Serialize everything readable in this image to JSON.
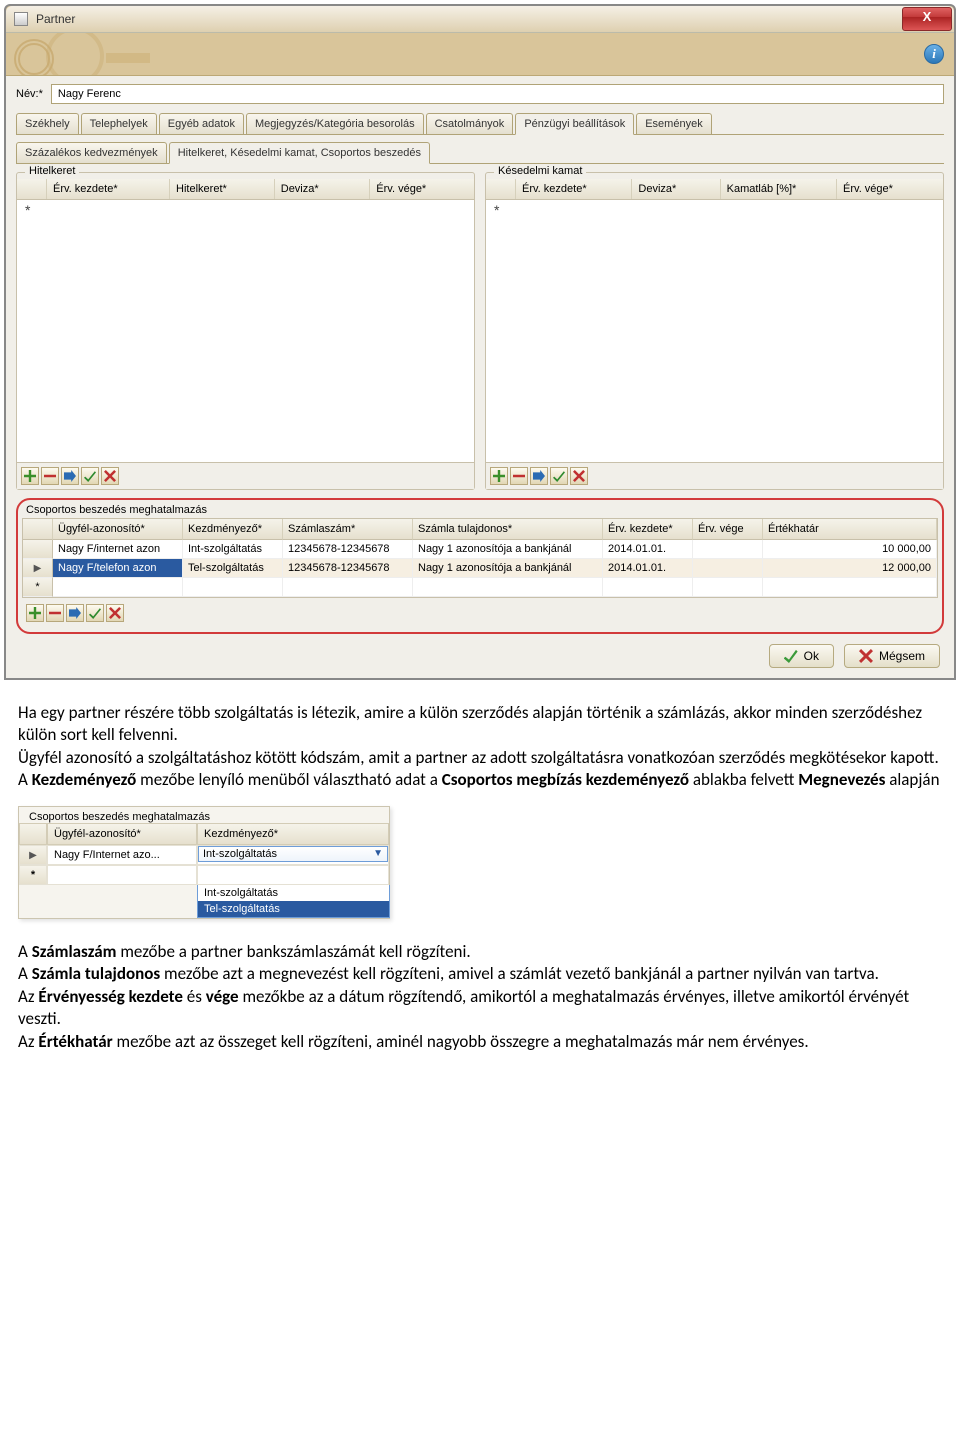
{
  "window": {
    "title": "Partner"
  },
  "name": {
    "label": "Név:*",
    "value": "Nagy Ferenc"
  },
  "main_tabs": {
    "items": [
      "Székhely",
      "Telephelyek",
      "Egyéb adatok",
      "Megjegyzés/Kategória besorolás",
      "Csatolmányok",
      "Pénzügyi beállítások",
      "Események"
    ],
    "active_index": 5
  },
  "sub_tabs": {
    "items": [
      "Százalékos kedvezmények",
      "Hitelkeret, Késedelmi kamat, Csoportos beszedés"
    ],
    "active_index": 1
  },
  "hitelkeret": {
    "title": "Hitelkeret",
    "columns": [
      "Érv. kezdete*",
      "Hitelkeret*",
      "Deviza*",
      "Érv. vége*"
    ]
  },
  "kesedelmi": {
    "title": "Késedelmi kamat",
    "columns": [
      "Érv. kezdete*",
      "Deviza*",
      "Kamatláb [%]*",
      "Érv. vége*"
    ]
  },
  "auth": {
    "title": "Csoportos beszedés meghatalmazás",
    "columns": [
      "Ügyfél-azonosító*",
      "Kezdményező*",
      "Számlaszám*",
      "Számla tulajdonos*",
      "Érv. kezdete*",
      "Érv. vége",
      "Értékhatár"
    ],
    "rows": [
      {
        "ugyfel": "Nagy F/internet azon",
        "kezdm": "Int-szolgáltatás",
        "szamla": "12345678-12345678",
        "tulaj": "Nagy 1 azonosítója a bankjánál",
        "kezd": "2014.01.01.",
        "vege": "",
        "ertek": "10 000,00"
      },
      {
        "ugyfel": "Nagy F/telefon azon",
        "kezdm": "Tel-szolgáltatás",
        "szamla": "12345678-12345678",
        "tulaj": "Nagy 1 azonosítója a bankjánál",
        "kezd": "2014.01.01.",
        "vege": "",
        "ertek": "12 000,00"
      }
    ]
  },
  "buttons": {
    "ok": "Ok",
    "cancel": "Mégsem"
  },
  "mini": {
    "title": "Csoportos beszedés meghatalmazás",
    "col1": "Ügyfél-azonosító*",
    "col2": "Kezdményező*",
    "row_ugyfel": "Nagy F/Internet azo...",
    "selected": "Int-szolgáltatás",
    "opt1": "Int-szolgáltatás",
    "opt2": "Tel-szolgáltatás"
  },
  "article": {
    "p1a": "Ha egy partner részére több szolgáltatás is létezik, amire a külön szerződés alapján történik a számlázás, akkor minden szerződéshez külön sort kell felvenni.",
    "p2a": "Ügyfél azonosító a szolgáltatáshoz kötött kódszám, amit a partner az adott szolgáltatásra vonatkozóan szerződés megkötésekor kapott.",
    "p3a": "A ",
    "p3b": "Kezdeményező",
    "p3c": " mezőbe lenyíló menüből választható adat a ",
    "p3d": "Csoportos megbízás kezdeményező",
    "p3e": " ablakba felvett ",
    "p3f": "Megnevezés",
    "p3g": " alapján",
    "p4a": "A ",
    "p4b": "Számlaszám",
    "p4c": " mezőbe a partner bankszámlaszámát kell rögzíteni.",
    "p5a": "A ",
    "p5b": "Számla tulajdonos",
    "p5c": " mezőbe azt a megnevezést kell rögzíteni, amivel a számlát vezető bankjánál a partner nyilván van tartva.",
    "p6a": "Az ",
    "p6b": "Érvényesség kezdete",
    "p6c": " és ",
    "p6d": "vége",
    "p6e": " mezőkbe az a dátum rögzítendő, amikortól a meghatalmazás érvényes, illetve amikortól érvényét veszti.",
    "p7a": "Az ",
    "p7b": "Értékhatár",
    "p7c": " mezőbe azt az összeget kell rögzíteni, aminél nagyobb összegre a meghatalmazás már nem érvényes."
  }
}
